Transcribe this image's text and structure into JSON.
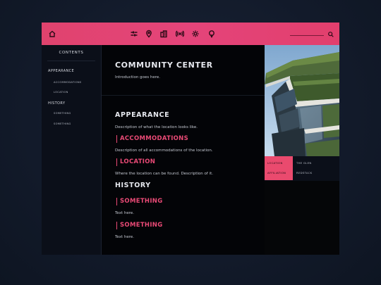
{
  "nav": {
    "icons": [
      "home-icon",
      "arrows-icon",
      "pin-icon",
      "buildings-icon",
      "broadcast-icon",
      "gear-icon",
      "bulb-icon",
      "search-icon"
    ],
    "accent": "#e4447a"
  },
  "sidebar": {
    "title": "CONTENTS",
    "items": [
      {
        "label": "APPEARANCE",
        "level": 1
      },
      {
        "label": "ACCOMMODATIONS",
        "level": 2
      },
      {
        "label": "LOCATION",
        "level": 2
      },
      {
        "label": "HISTORY",
        "level": 1
      },
      {
        "label": "SOMETHING",
        "level": 2
      },
      {
        "label": "SOMETHING",
        "level": 2
      }
    ]
  },
  "article": {
    "title": "COMMUNITY CENTER",
    "intro": "Introduction goes here.",
    "appearance_heading": "APPEARANCE",
    "appearance_text": "Description of what the location looks like.",
    "accommodations_heading": "ACCOMMODATIONS",
    "accommodations_text": "Description of all accommodations of the location.",
    "location_heading": "LOCATION",
    "location_text": "Where the location can be found. Description of it.",
    "history_heading": "HISTORY",
    "something1_heading": "SOMETHING",
    "something1_text": "Text here.",
    "something2_heading": "SOMETHING",
    "something2_text": "Text here."
  },
  "infobox": {
    "rows": [
      {
        "key": "LOCATION",
        "value": "THE GLEN"
      },
      {
        "key": "AFFILIATION",
        "value": "REDSTACK"
      }
    ]
  }
}
